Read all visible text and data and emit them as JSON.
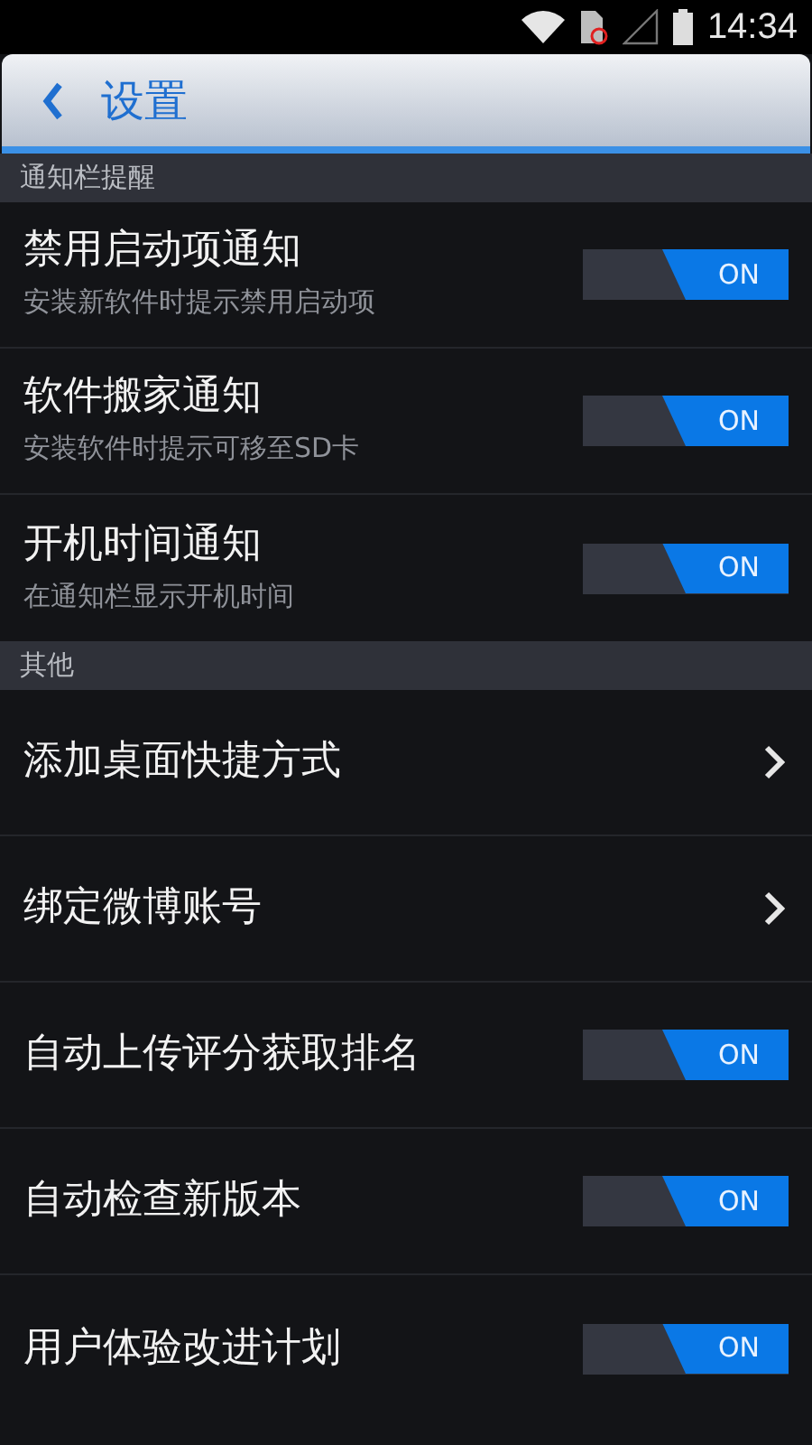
{
  "status_bar": {
    "time": "14:34"
  },
  "header": {
    "title": "设置"
  },
  "sections": [
    {
      "title": "通知栏提醒",
      "items": [
        {
          "kind": "toggle",
          "title": "禁用启动项通知",
          "subtitle": "安装新软件时提示禁用启动项",
          "on": true,
          "switch_label": "ON"
        },
        {
          "kind": "toggle",
          "title": "软件搬家通知",
          "subtitle": "安装软件时提示可移至SD卡",
          "on": true,
          "switch_label": "ON"
        },
        {
          "kind": "toggle",
          "title": "开机时间通知",
          "subtitle": "在通知栏显示开机时间",
          "on": true,
          "switch_label": "ON"
        }
      ]
    },
    {
      "title": "其他",
      "items": [
        {
          "kind": "link",
          "title": "添加桌面快捷方式"
        },
        {
          "kind": "link",
          "title": "绑定微博账号"
        },
        {
          "kind": "toggle",
          "title": "自动上传评分获取排名",
          "on": true,
          "switch_label": "ON"
        },
        {
          "kind": "toggle",
          "title": "自动检查新版本",
          "on": true,
          "switch_label": "ON"
        },
        {
          "kind": "toggle",
          "title": "用户体验改进计划",
          "on": true,
          "switch_label": "ON"
        }
      ]
    }
  ]
}
